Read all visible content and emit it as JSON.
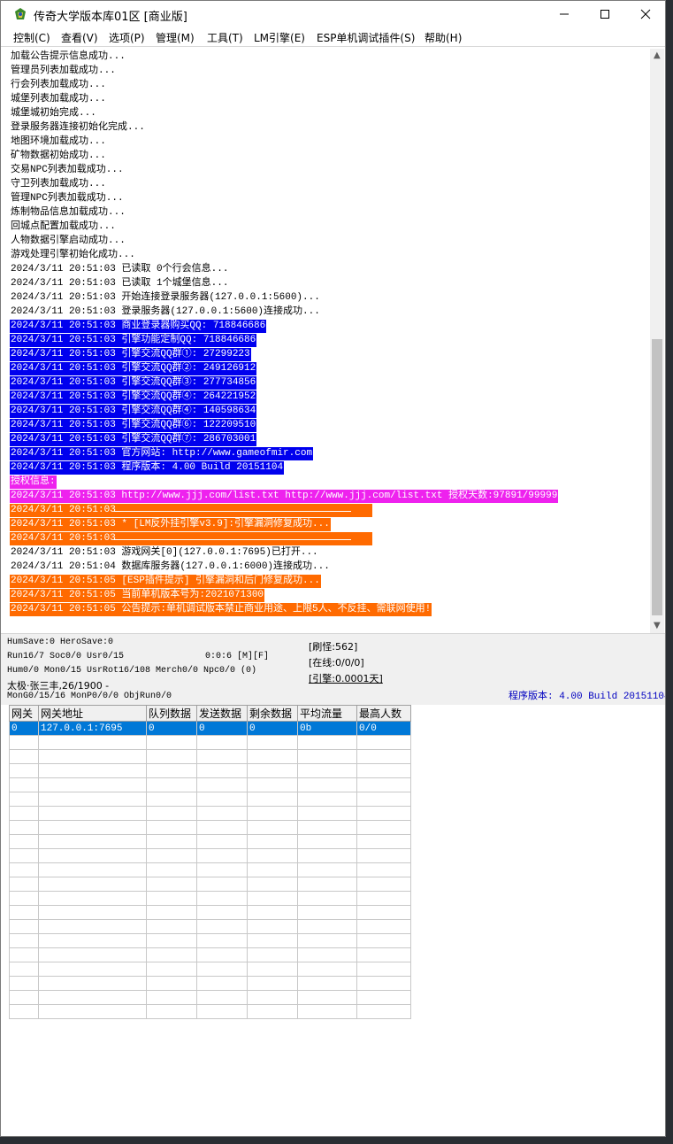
{
  "window": {
    "title": "传奇大学版本库01区 [商业版]",
    "minimize": "—",
    "maximize": "☐",
    "close": "✕"
  },
  "menu": [
    "控制(C)",
    "查看(V)",
    "选项(P)",
    "管理(M)",
    "工具(T)",
    "LM引擎(E)",
    "ESP单机调试插件(S)",
    "帮助(H)"
  ],
  "log": [
    {
      "text": "加载公告提示信息成功...",
      "style": "plain"
    },
    {
      "text": "管理员列表加载成功...",
      "style": "plain"
    },
    {
      "text": "行会列表加载成功...",
      "style": "plain"
    },
    {
      "text": "城堡列表加载成功...",
      "style": "plain"
    },
    {
      "text": "城堡城初始完成...",
      "style": "plain"
    },
    {
      "text": "登录服务器连接初始化完成...",
      "style": "plain"
    },
    {
      "text": "地图环境加载成功...",
      "style": "plain"
    },
    {
      "text": "矿物数据初始成功...",
      "style": "plain"
    },
    {
      "text": "交易NPC列表加载成功...",
      "style": "plain"
    },
    {
      "text": "守卫列表加载成功...",
      "style": "plain"
    },
    {
      "text": "管理NPC列表加载成功...",
      "style": "plain"
    },
    {
      "text": "炼制物品信息加载成功...",
      "style": "plain"
    },
    {
      "text": "回城点配置加载成功...",
      "style": "plain"
    },
    {
      "text": "人物数据引擎启动成功...",
      "style": "plain"
    },
    {
      "text": "游戏处理引擎初始化成功...",
      "style": "plain"
    },
    {
      "text": "2024/3/11 20:51:03 已读取 0个行会信息...",
      "style": "plain"
    },
    {
      "text": "2024/3/11 20:51:03 已读取 1个城堡信息...",
      "style": "plain"
    },
    {
      "text": "2024/3/11 20:51:03 开始连接登录服务器(127.0.0.1:5600)...",
      "style": "plain"
    },
    {
      "text": "2024/3/11 20:51:03 登录服务器(127.0.0.1:5600)连接成功...",
      "style": "plain"
    },
    {
      "text": "2024/3/11 20:51:03 商业登录器购买QQ: 718846686",
      "style": "blue"
    },
    {
      "text": "2024/3/11 20:51:03 引擎功能定制QQ: 718846686",
      "style": "blue"
    },
    {
      "text": "2024/3/11 20:51:03 引擎交流QQ群①: 27299223",
      "style": "blue"
    },
    {
      "text": "2024/3/11 20:51:03 引擎交流QQ群②: 249126912",
      "style": "blue"
    },
    {
      "text": "2024/3/11 20:51:03 引擎交流QQ群③: 277734856",
      "style": "blue"
    },
    {
      "text": "2024/3/11 20:51:03 引擎交流QQ群④: 264221952",
      "style": "blue"
    },
    {
      "text": "2024/3/11 20:51:03 引擎交流QQ群④: 140598634",
      "style": "blue"
    },
    {
      "text": "2024/3/11 20:51:03 引擎交流QQ群⑥: 122209510",
      "style": "blue"
    },
    {
      "text": "2024/3/11 20:51:03 引擎交流QQ群⑦: 286703001",
      "style": "blue"
    },
    {
      "text": "2024/3/11 20:51:03 官方网站: http://www.gameofmir.com",
      "style": "blue"
    },
    {
      "text": "2024/3/11 20:51:03 程序版本: 4.00 Build 20151104",
      "style": "blue"
    },
    {
      "text": "授权信息:",
      "style": "mag"
    },
    {
      "text": "2024/3/11 20:51:03 http://www.jjj.com/list.txt http://www.jjj.com/list.txt 授权天数:97891/99999",
      "style": "mag"
    },
    {
      "text": "2024/3/11 20:51:03 ",
      "style": "org",
      "rule": true,
      "pad": 284
    },
    {
      "text": "2024/3/11 20:51:03 * [LM反外挂引擎v3.9]:引擎漏洞修复成功...",
      "style": "org"
    },
    {
      "text": "2024/3/11 20:51:03 ",
      "style": "org",
      "rule": true,
      "pad": 284
    },
    {
      "text": "2024/3/11 20:51:03 游戏网关[0](127.0.0.1:7695)已打开...",
      "style": "plain"
    },
    {
      "text": "2024/3/11 20:51:04 数据库服务器(127.0.0.1:6000)连接成功...",
      "style": "plain"
    },
    {
      "text": "2024/3/11 20:51:05 [ESP插件提示] 引擎漏洞和后门修复成功...",
      "style": "org"
    },
    {
      "text": "2024/3/11 20:51:05 当前单机版本号为:2021071300",
      "style": "org"
    },
    {
      "text": "2024/3/11 20:51:05 公告提示:单机调试版本禁止商业用途、上限5人、不反挂、需联网使用!",
      "style": "org"
    }
  ],
  "status": {
    "line1": "HumSave:0 HeroSave:0",
    "line2": "Run16/7 Soc0/0 Usr0/15",
    "timer": "0:0:6 [M][F]",
    "line3": "Hum0/0 Mon0/15 UsrRot16/108 Merch0/0 Npc0/0 (0)",
    "line4": "太极·张三丰,26/1900 -",
    "line5": "MonG0/15/16 MonP0/0/0 ObjRun0/0",
    "refresh": "[刷怪:562]",
    "online": "[在线:0/0/0]",
    "engine": "[引擎:0.0001天]",
    "version": "程序版本: 4.00 Build 20151104",
    "version_color": "#0000c0"
  },
  "grid": {
    "headers": [
      "网关",
      "网关地址",
      "队列数据",
      "发送数据",
      "剩余数据",
      "平均流量",
      "最高人数"
    ],
    "rows": [
      [
        "0",
        "127.0.0.1:7695",
        "0",
        "0",
        "0",
        "0b",
        "0/0"
      ]
    ],
    "empty_rows": 20
  },
  "colors": {
    "blue_bg": "#0000ee",
    "magenta_bg": "#ee22ee",
    "orange_bg": "#ff6a00",
    "selection": "#0078d7"
  }
}
